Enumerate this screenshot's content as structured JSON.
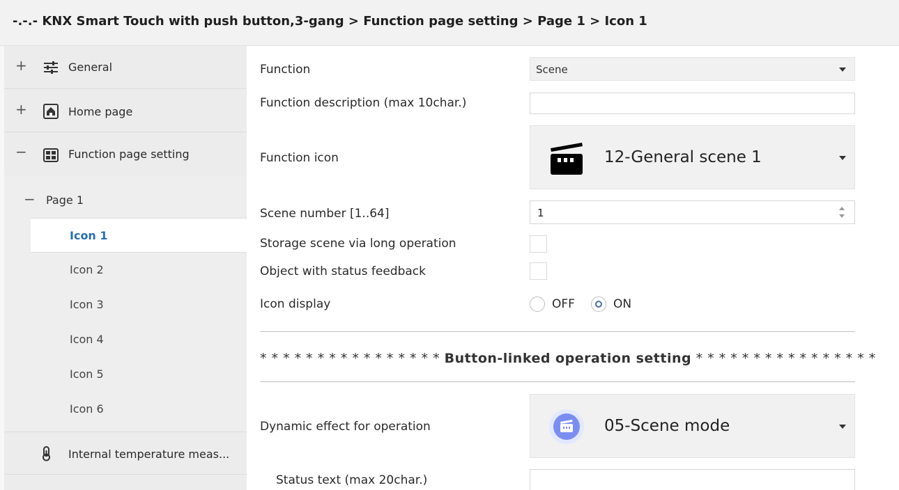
{
  "breadcrumb": "-.-.- KNX Smart Touch with push button,3-gang > Function page setting > Page 1 > Icon 1",
  "sidebar": {
    "items": [
      {
        "toggle": "+",
        "label": "General",
        "icon": "sliders-icon"
      },
      {
        "toggle": "+",
        "label": "Home page",
        "icon": "home-icon"
      },
      {
        "toggle": "−",
        "label": "Function page setting",
        "icon": "grid-icon"
      }
    ],
    "page": {
      "toggle": "−",
      "label": "Page 1"
    },
    "icons": [
      "Icon 1",
      "Icon 2",
      "Icon 3",
      "Icon 4",
      "Icon 5",
      "Icon 6"
    ],
    "active_icon": "Icon 1",
    "temp_item": {
      "label": "Internal temperature meas...",
      "icon": "thermometer-icon"
    }
  },
  "form": {
    "function": {
      "label": "Function",
      "value": "Scene"
    },
    "description": {
      "label": "Function description (max 10char.)",
      "value": ""
    },
    "function_icon": {
      "label": "Function icon",
      "value": "12-General scene 1",
      "icon": "clapperboard-icon"
    },
    "scene_number": {
      "label": "Scene number [1..64]",
      "value": "1"
    },
    "storage_scene": {
      "label": "Storage scene via long operation",
      "checked": false
    },
    "status_feedback": {
      "label": "Object with status feedback",
      "checked": false
    },
    "icon_display": {
      "label": "Icon display",
      "off": "OFF",
      "on": "ON",
      "selected": "ON"
    },
    "section_stars_left": "* * * * * * * * * * * * * * * *",
    "section_title": "Button-linked operation setting",
    "section_stars_right": "* * * * * * * * * * * * * * * *",
    "dynamic_effect": {
      "label": "Dynamic effect for operation",
      "value": "05-Scene mode",
      "icon": "scene-mode-icon"
    },
    "status_text": {
      "label": "Status text (max 20char.)",
      "value": ""
    }
  },
  "colors": {
    "active_text": "#2a6ea8",
    "radio_accent": "#4a6fa5",
    "scene_icon_bg": "#7b8ef0"
  }
}
